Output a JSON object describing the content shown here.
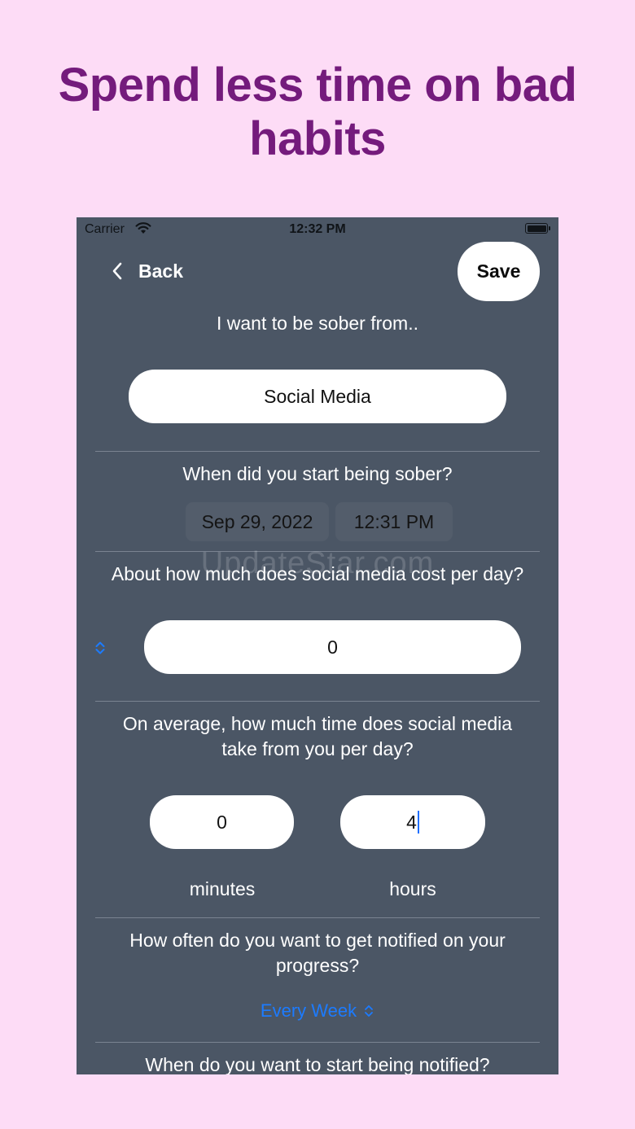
{
  "headline": "Spend less time on bad habits",
  "status_bar": {
    "carrier": "Carrier",
    "time": "12:32 PM"
  },
  "nav": {
    "back_label": "Back",
    "save_label": "Save"
  },
  "form": {
    "sober_from_label": "I want to be sober from..",
    "sober_from_value": "Social Media",
    "start_label": "When did you start being sober?",
    "start_date": "Sep 29, 2022",
    "start_time": "12:31 PM",
    "cost_label": "About how much does social media cost per day?",
    "cost_value": "0",
    "time_label": "On average, how much time does social media take from you per day?",
    "minutes_value": "0",
    "hours_value": "4",
    "minutes_label": "minutes",
    "hours_label": "hours",
    "notify_label": "How often do you want to get notified on your progress?",
    "notify_frequency": "Every Week",
    "notify_start_label": "When do you want to start being notified?"
  },
  "watermark": "UpdateStar.com",
  "colors": {
    "background": "#fddcf6",
    "headline": "#741b7c",
    "panel": "#4b5665",
    "accent": "#1c7bff"
  }
}
